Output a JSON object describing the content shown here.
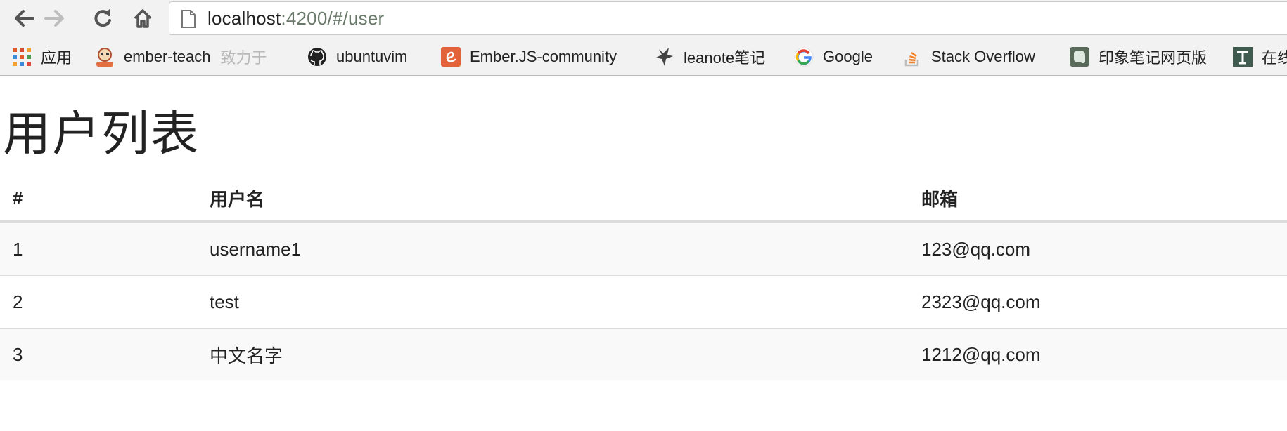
{
  "browser": {
    "url_host": "localhost",
    "url_rest": ":4200/#/user"
  },
  "bookmarks": [
    {
      "label": "应用",
      "icon": "apps-grid-icon"
    },
    {
      "label": "ember-teach",
      "extra": "致力于",
      "icon": "ember-teach-icon"
    },
    {
      "label": "ubuntuvim",
      "icon": "github-icon"
    },
    {
      "label": "Ember.JS-community",
      "icon": "ember-e-icon"
    },
    {
      "label": "leanote笔记",
      "icon": "leanote-icon"
    },
    {
      "label": "Google",
      "icon": "google-icon"
    },
    {
      "label": "Stack Overflow",
      "icon": "stackoverflow-icon"
    },
    {
      "label": "印象笔记网页版",
      "icon": "evernote-icon"
    },
    {
      "label": "在线",
      "icon": "text-t-icon"
    }
  ],
  "page": {
    "title": "用户列表"
  },
  "table": {
    "headers": [
      "#",
      "用户名",
      "邮箱"
    ],
    "rows": [
      [
        "1",
        "username1",
        "123@qq.com"
      ],
      [
        "2",
        "test",
        "2323@qq.com"
      ],
      [
        "3",
        "中文名字",
        "1212@qq.com"
      ]
    ]
  },
  "colors": {
    "stripe": "#f9f9f9",
    "header_border": "#dcdcdc",
    "row_border": "#dddddd",
    "toolbar_bg": "#f2f2f2"
  }
}
